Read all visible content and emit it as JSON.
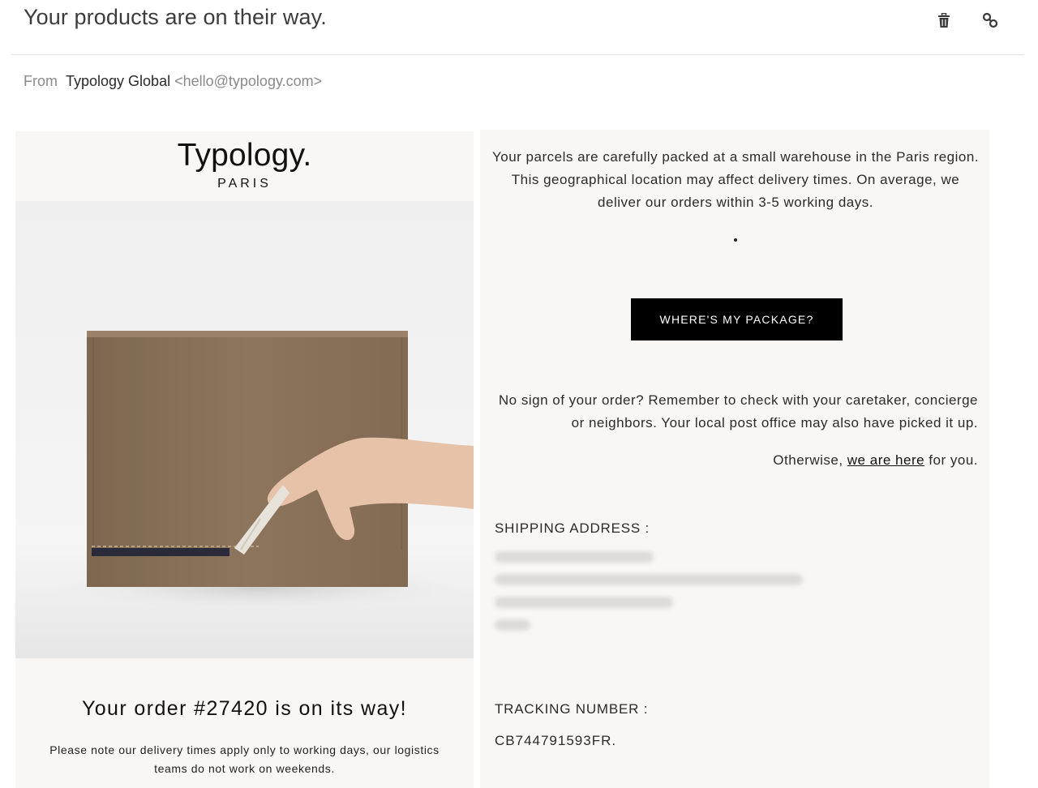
{
  "email": {
    "subject": "Your products are on their way.",
    "from_label": "From",
    "from_name": "Typology Global",
    "from_email": "<hello@typology.com>",
    "icons": [
      "trash-icon",
      "link-icon"
    ]
  },
  "brand": {
    "logo": "Typology.",
    "sub": "PARIS"
  },
  "hero": {
    "colors": {
      "background": "#f2f2f2",
      "box": "#8d755d"
    }
  },
  "order": {
    "title": "Your order #27420 is on its way!",
    "note": "Please note our delivery times apply only to working days, our logistics teams do not work on weekends."
  },
  "info": {
    "intro": "Your parcels are carefully packed at a small warehouse in the Paris region. This geographical location may affect delivery times. On average, we deliver our orders within 3-5 working days.",
    "cta_label": "WHERE'S MY PACKAGE?",
    "help_text": "No sign of your order? Remember to check with your caretaker, concierge or neighbors. Your local post office may also have picked it up.",
    "otherwise_prefix": "Otherwise,",
    "otherwise_link": "we are here",
    "otherwise_suffix": "for you."
  },
  "shipping": {
    "label": "SHIPPING ADDRESS :"
  },
  "tracking": {
    "label": "TRACKING NUMBER :",
    "number": "CB744791593FR."
  },
  "colors": {
    "panel_bg": "#f8f7f5",
    "cta_bg": "#000000",
    "cta_text": "#ffffff"
  }
}
